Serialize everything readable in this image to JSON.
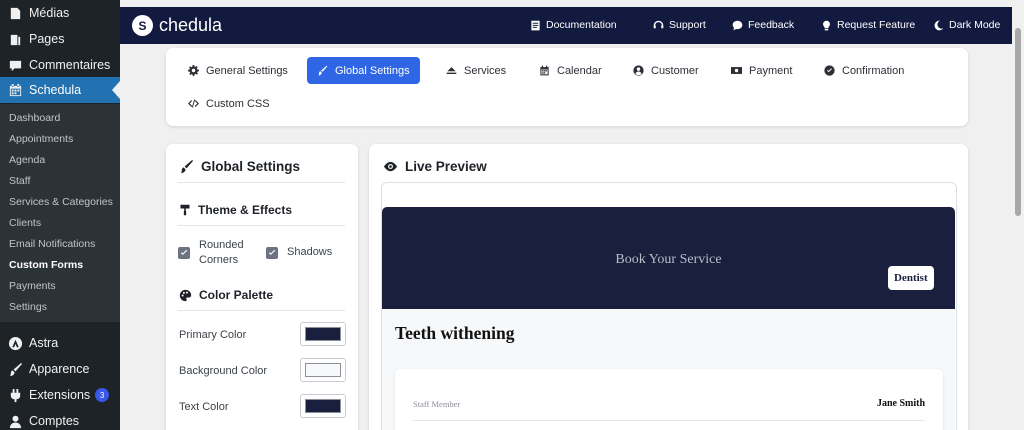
{
  "wp_menu": {
    "items_top": [
      {
        "label": "Médias",
        "icon": "media-icon"
      },
      {
        "label": "Pages",
        "icon": "pages-icon"
      },
      {
        "label": "Commentaires",
        "icon": "comments-icon"
      },
      {
        "label": "Schedula",
        "icon": "calendar-icon"
      }
    ],
    "submenu": [
      {
        "label": "Dashboard"
      },
      {
        "label": "Appointments"
      },
      {
        "label": "Agenda"
      },
      {
        "label": "Staff"
      },
      {
        "label": "Services & Categories"
      },
      {
        "label": "Clients"
      },
      {
        "label": "Email Notifications"
      },
      {
        "label": "Custom Forms"
      },
      {
        "label": "Payments"
      },
      {
        "label": "Settings"
      }
    ],
    "items_bottom": [
      {
        "label": "Astra",
        "icon": "astra-icon"
      },
      {
        "label": "Apparence",
        "icon": "brush-icon"
      },
      {
        "label": "Extensions",
        "icon": "plugin-icon",
        "badge": "3"
      },
      {
        "label": "Comptes",
        "icon": "user-icon"
      }
    ]
  },
  "header": {
    "logo_letter": "S",
    "brand": "chedula",
    "links": [
      {
        "label": "Documentation",
        "icon": "document-icon"
      },
      {
        "label": "Support",
        "icon": "support-icon"
      },
      {
        "label": "Feedback",
        "icon": "chat-icon"
      },
      {
        "label": "Request Feature",
        "icon": "lightbulb-icon"
      },
      {
        "label": "Dark Mode",
        "icon": "moon-icon"
      }
    ]
  },
  "tabs": [
    {
      "label": "General Settings",
      "icon": "gear-icon"
    },
    {
      "label": "Global Settings",
      "icon": "brush-icon",
      "active": true
    },
    {
      "label": "Services",
      "icon": "services-icon"
    },
    {
      "label": "Calendar",
      "icon": "calendar-icon"
    },
    {
      "label": "Customer",
      "icon": "user-circle-icon"
    },
    {
      "label": "Payment",
      "icon": "money-icon"
    },
    {
      "label": "Confirmation",
      "icon": "check-circle-icon"
    },
    {
      "label": "Custom CSS",
      "icon": "code-icon"
    }
  ],
  "settings": {
    "title": "Global Settings",
    "theme": {
      "title": "Theme & Effects",
      "rounded_line1": "Rounded",
      "rounded_line2": "Corners",
      "shadows": "Shadows"
    },
    "palette": {
      "title": "Color Palette",
      "primary_label": "Primary Color",
      "background_label": "Background Color",
      "text_label": "Text Color"
    }
  },
  "colors": {
    "primary": "#1a1f3d",
    "background": "#f7f8fa",
    "text": "#1a1f3d",
    "accent": "#2f66e6",
    "header": "#121a3f"
  },
  "preview": {
    "title": "Live Preview",
    "hero_title": "Book Your Service",
    "category_badge": "Dentist",
    "service_name": "Teeth withening",
    "staff_label": "Staff Member",
    "staff_value": "Jane Smith"
  }
}
